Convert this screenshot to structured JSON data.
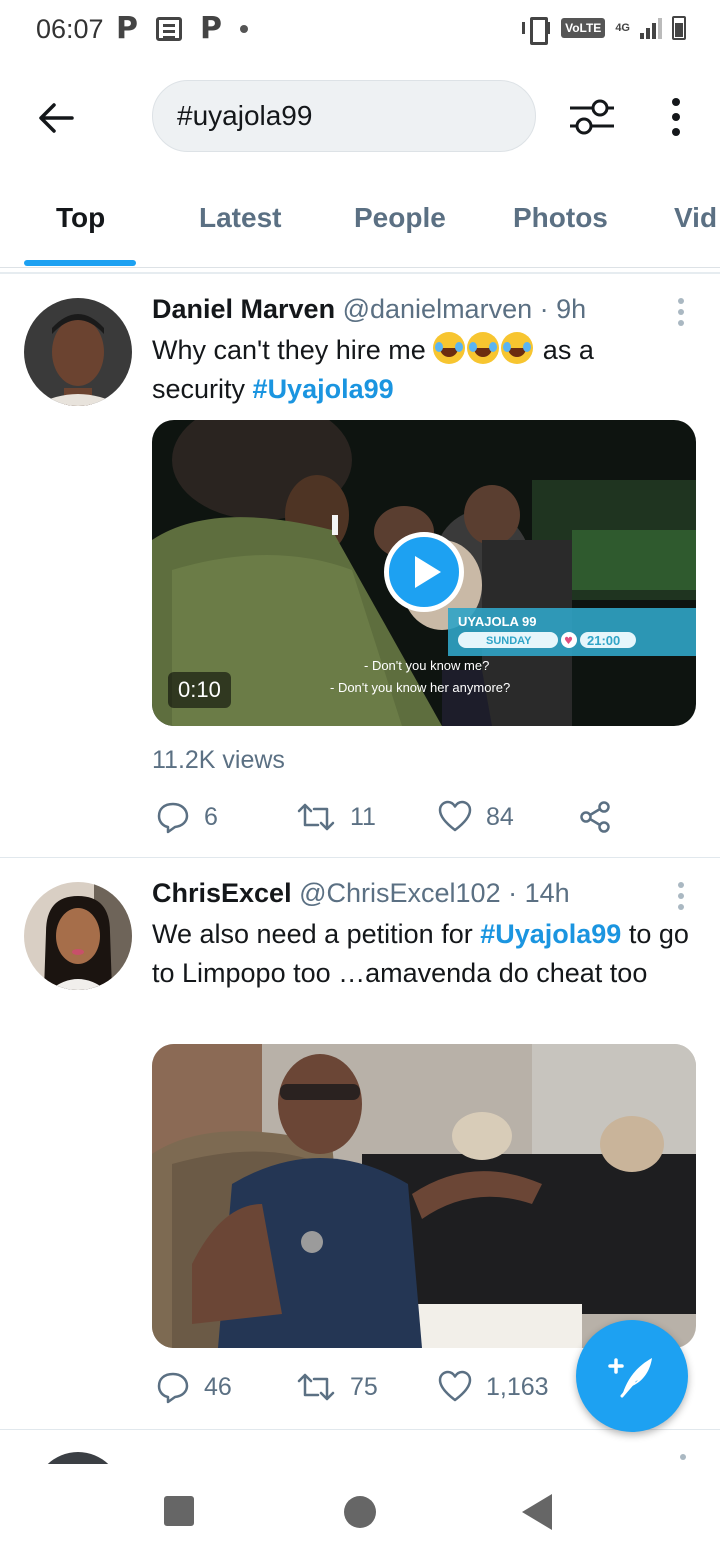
{
  "status_bar": {
    "time": "06:07",
    "volte": "VoLTE",
    "network": "4G"
  },
  "search": {
    "query": "#uyajola99"
  },
  "tabs": [
    {
      "label": "Top",
      "active": true
    },
    {
      "label": "Latest",
      "active": false
    },
    {
      "label": "People",
      "active": false
    },
    {
      "label": "Photos",
      "active": false
    },
    {
      "label": "Vid",
      "active": false
    }
  ],
  "tweets": [
    {
      "name": "Daniel Marven",
      "handle": "@danielmarven",
      "time": "9h",
      "text_before": "Why can't they hire me",
      "emoji": "face-with-tears-of-joy x3",
      "text_after": "as a security",
      "hashtag": "#Uyajola99",
      "media": {
        "type": "video",
        "duration": "0:10",
        "overlay_brand": "UYAJOLA 99",
        "overlay_day": "SUNDAY",
        "overlay_time": "21:00",
        "subtitle_1": "- Don't you know me?",
        "subtitle_2": "- Don't you know her anymore?"
      },
      "views": "11.2K views",
      "replies": "6",
      "retweets": "11",
      "likes": "84"
    },
    {
      "name": "ChrisExcel",
      "handle": "@ChrisExcel102",
      "time": "14h",
      "text_before": "We also need a petition for",
      "hashtag": "#Uyajola99",
      "text_after": "to go to Limpopo too …amavenda do cheat too",
      "media": {
        "type": "photo"
      },
      "replies": "46",
      "retweets": "75",
      "likes": "1,163"
    }
  ],
  "colors": {
    "accent": "#1da1f2",
    "hashtag": "#1b95e0",
    "secondary_text": "#5b7083"
  },
  "icons": {
    "back": "arrow-left-icon",
    "filter": "sliders-icon",
    "more": "more-vertical-icon",
    "compose": "compose-tweet-icon"
  }
}
